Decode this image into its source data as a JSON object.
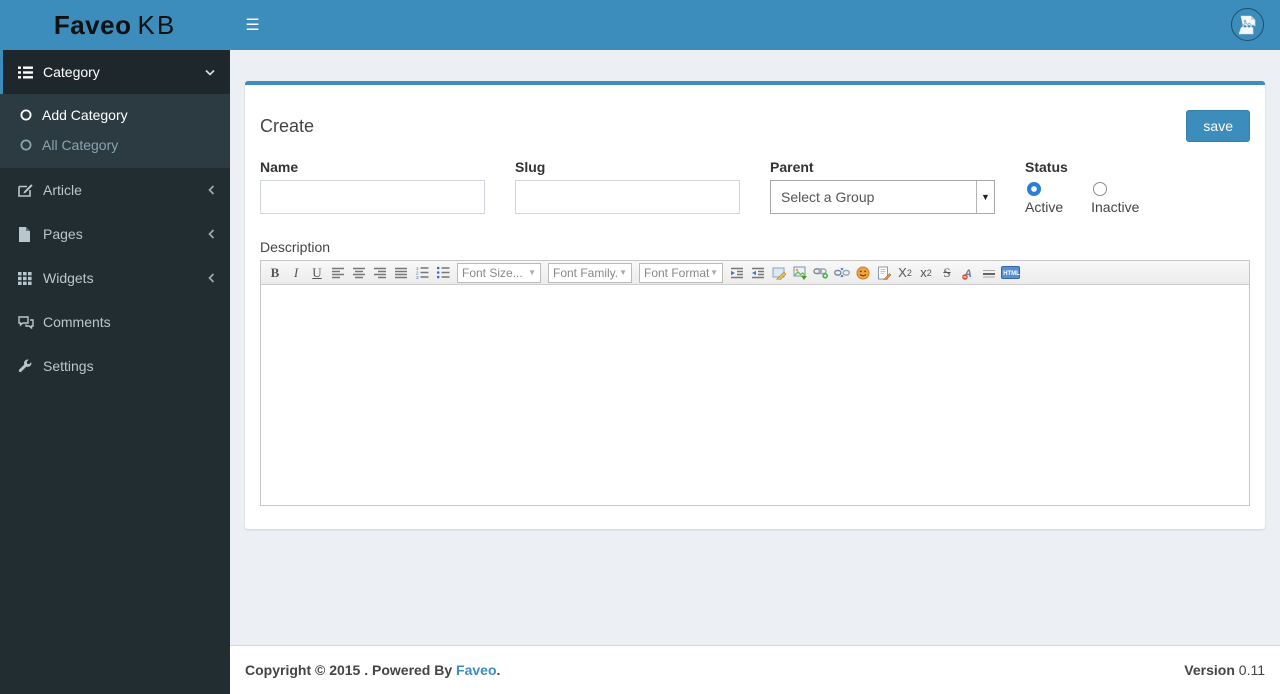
{
  "logo": {
    "bold": "Faveo",
    "light": "KB"
  },
  "navbar": {
    "hamburger_icon": "hamburger-menu-icon",
    "avatar_icon": "broken-image-avatar-icon"
  },
  "sidebar": {
    "category_label": "Category",
    "add_category_label": "Add Category",
    "all_category_label": "All Category",
    "article_label": "Article",
    "pages_label": "Pages",
    "widgets_label": "Widgets",
    "comments_label": "Comments",
    "settings_label": "Settings"
  },
  "page": {
    "title": "Create",
    "save_button": "save"
  },
  "form": {
    "name_label": "Name",
    "name_value": "",
    "slug_label": "Slug",
    "slug_value": "",
    "parent_label": "Parent",
    "parent_selected_option": "Select a Group",
    "status_label": "Status",
    "status_options": [
      {
        "label": "Active",
        "selected": true
      },
      {
        "label": "Inactive",
        "selected": false
      }
    ],
    "description_label": "Description",
    "description_value": ""
  },
  "editor_toolbar": {
    "bold": "B",
    "italic": "I",
    "underline": "U",
    "font_size_select": "Font Size...",
    "font_family_select": "Font Family.",
    "font_format_select": "Font Format",
    "dropdown_arrow": "▼",
    "subscript_base": "X",
    "subscript_small": "2",
    "superscript_base": "x",
    "superscript_small": "2",
    "strikethrough": "S",
    "html_source": "HTML",
    "icon_names": [
      "bold",
      "italic",
      "underline",
      "align-left",
      "align-center",
      "align-right",
      "align-justify",
      "ordered-list",
      "unordered-list",
      "font-size-select",
      "font-family-select",
      "font-format-select",
      "indent",
      "outdent",
      "edit-image",
      "insert-image",
      "insert-link",
      "unlink",
      "emoticons",
      "insert-template",
      "subscript",
      "superscript",
      "strikethrough",
      "remove-format",
      "horizontal-rule",
      "html-source"
    ]
  },
  "footer": {
    "copyright_text": "Copyright © 2015 . Powered By",
    "brand_link": "Faveo",
    "period": ".",
    "version_label": "Version",
    "version_value": "0.11"
  },
  "colors": {
    "navbar_blue": "#3c8dbc",
    "sidebar_dark": "#222d32",
    "submenu_dark": "#2c3b41",
    "active_item_dark": "#1e282c",
    "page_background": "#ecf0f5",
    "save_button_blue": "#3c8dbc",
    "radio_checked_blue": "#2a7fd4",
    "footer_link_blue": "#3c8dbc"
  }
}
